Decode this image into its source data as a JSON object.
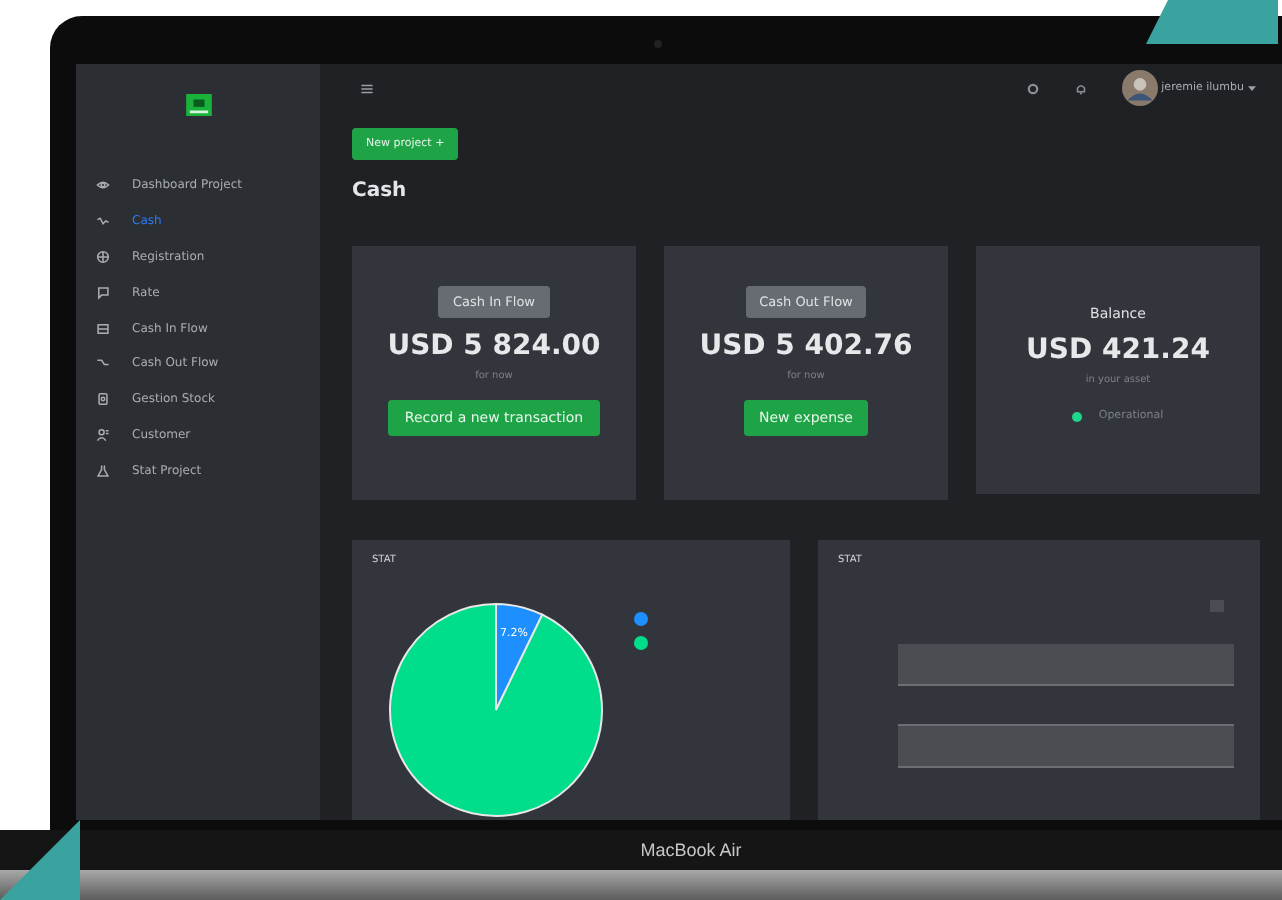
{
  "device_label": "MacBook Air",
  "sidebar": {
    "items": [
      {
        "label": "Dashboard Project",
        "selected": false
      },
      {
        "label": "Cash",
        "selected": true
      },
      {
        "label": "Registration",
        "selected": false
      },
      {
        "label": "Rate",
        "selected": false
      },
      {
        "label": "Cash In Flow",
        "selected": false
      },
      {
        "label": "Cash Out Flow",
        "selected": false
      },
      {
        "label": "Gestion Stock",
        "selected": false
      },
      {
        "label": "Customer",
        "selected": false
      },
      {
        "label": "Stat Project",
        "selected": false
      }
    ]
  },
  "topbar": {
    "user_name": "jeremie ilumbu"
  },
  "new_project_button": "New project +",
  "page_title": "Cash",
  "cards": [
    {
      "kind": "action",
      "tag": "Cash In Flow",
      "amount": "USD 5 824.00",
      "caption": "for now",
      "button": "Record a new transaction"
    },
    {
      "kind": "action",
      "tag": "Cash Out Flow",
      "amount": "USD 5 402.76",
      "caption": "for now",
      "button": "New expense"
    },
    {
      "kind": "status",
      "title": "Balance",
      "amount": "USD 421.24",
      "caption": "in your asset",
      "status": "Operational",
      "color": "#1fd88f"
    }
  ],
  "stat_panels": [
    {
      "kind": "pie",
      "title": "STAT",
      "legend": [
        {
          "color": "#1e8fff"
        },
        {
          "color": "#00de8c"
        }
      ],
      "chart_data": {
        "type": "pie",
        "values": [
          7.2,
          92.8
        ],
        "value_labels": [
          "7.2%",
          null
        ]
      }
    },
    {
      "kind": "bars",
      "title": "STAT"
    }
  ]
}
